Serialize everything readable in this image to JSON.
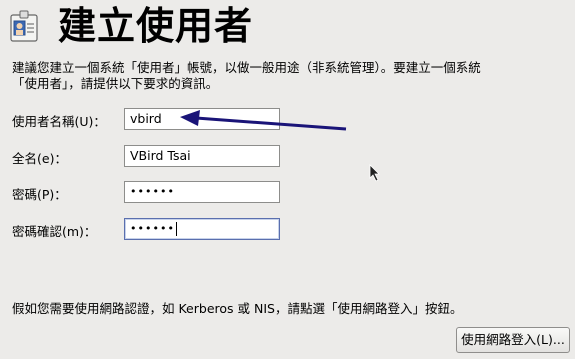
{
  "page": {
    "title": "建立使用者",
    "title_icon": "user-card-icon",
    "intro": "建議您建立一個系統「使用者」帳號，以做一般用途（非系統管理）。要建立一個系統\n「使用者」，請提供以下要求的資訊。"
  },
  "form": {
    "username": {
      "label": "使用者名稱(U)：",
      "value": "vbird"
    },
    "fullname": {
      "label": "全名(e)：",
      "value": "VBird Tsai"
    },
    "password": {
      "label": "密碼(P)：",
      "value": "••••••"
    },
    "confirm": {
      "label": "密碼確認(m)：",
      "value": "••••••"
    }
  },
  "footer": {
    "note": "假如您需要使用網路認證，如 Kerberos 或 NIS，請點選「使用網路登入」按鈕。",
    "network_login_button": "使用網路登入(L)..."
  },
  "colors": {
    "annotation_arrow": "#1a1478",
    "background": "#ecebe9"
  }
}
